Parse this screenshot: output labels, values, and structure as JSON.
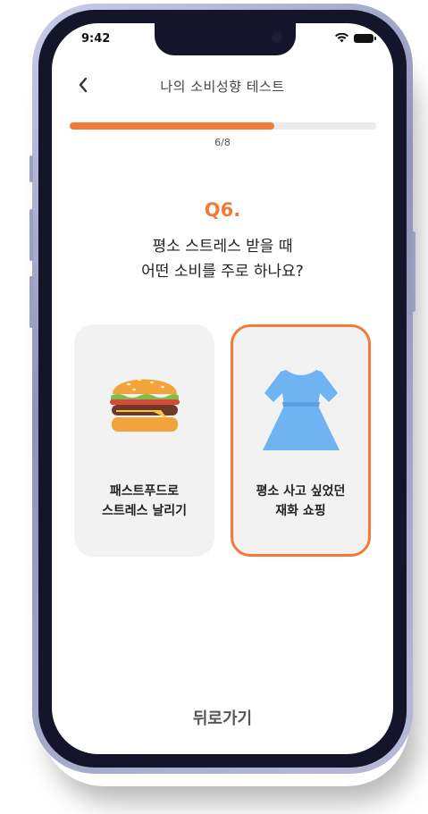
{
  "status_bar": {
    "time": "9:42"
  },
  "header": {
    "title": "나의 소비성향 테스트"
  },
  "progress": {
    "label": "6/8",
    "fraction": 0.667
  },
  "question": {
    "number": "Q6.",
    "line1": "평소 스트레스 받을 때",
    "line2": "어떤 소비를 주로 하나요?"
  },
  "options": [
    {
      "line1": "패스트푸드로",
      "line2": "스트레스 날리기",
      "icon": "burger-icon",
      "selected": false
    },
    {
      "line1": "평소 사고 싶었던",
      "line2": "재화 쇼핑",
      "icon": "dress-icon",
      "selected": true
    }
  ],
  "footer": {
    "back_label": "뒤로가기"
  },
  "colors": {
    "accent": "#f47a3a",
    "card_bg": "#f2f2f2",
    "track": "#ebebeb"
  }
}
